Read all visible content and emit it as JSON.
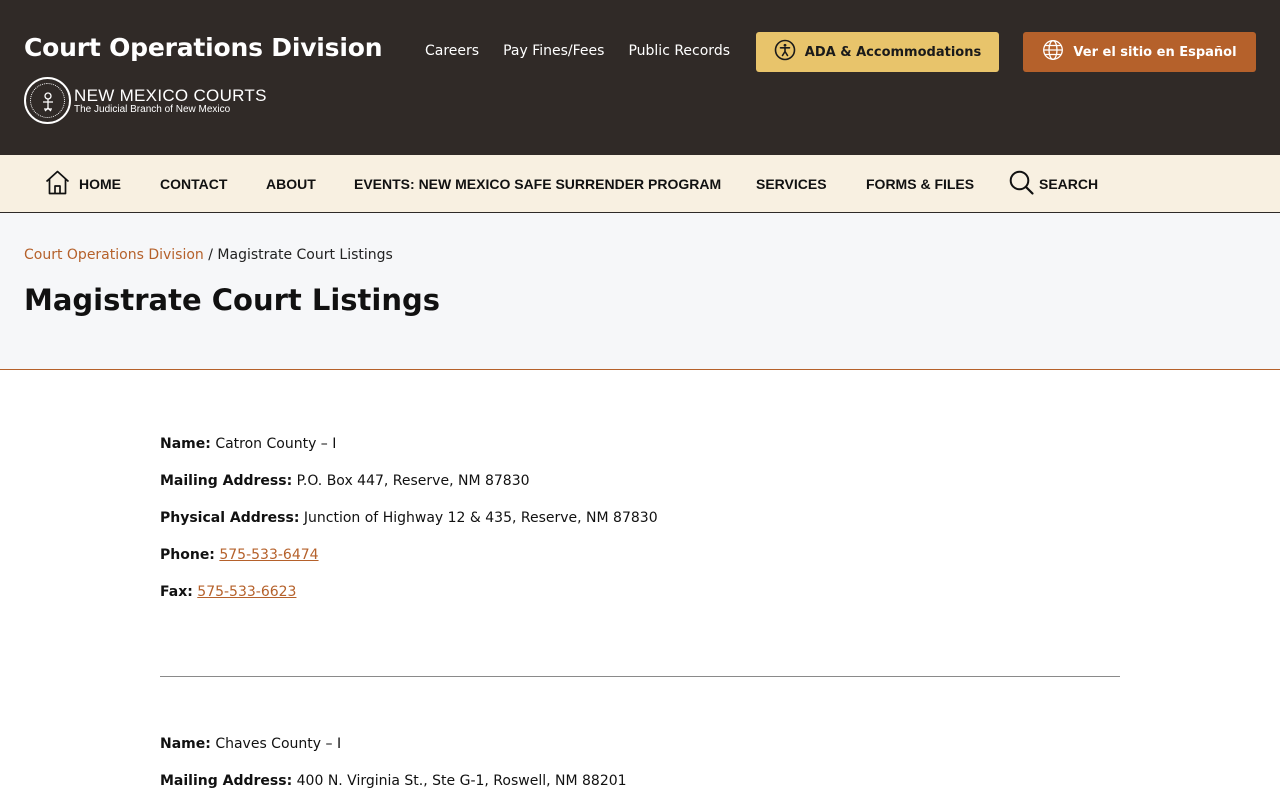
{
  "header": {
    "site_title": "Court Operations Division",
    "logo_main": "NEW MEXICO COURTS",
    "logo_sub": "The Judicial Branch of New Mexico",
    "links": [
      "Careers",
      "Pay Fines/Fees",
      "Public Records"
    ],
    "ada_button": "ADA & Accommodations",
    "spanish_button": "Ver el sitio en Español"
  },
  "nav": {
    "home": "HOME",
    "contact": "CONTACT",
    "about": "ABOUT",
    "events": "EVENTS: NEW MEXICO SAFE SURRENDER PROGRAM",
    "services": "SERVICES",
    "forms": "FORMS & FILES",
    "search": "SEARCH"
  },
  "breadcrumb": {
    "parent": "Court Operations Division",
    "separator": " / ",
    "current": "Magistrate Court Listings"
  },
  "page_title": "Magistrate Court Listings",
  "labels": {
    "name": "Name:",
    "mailing": "Mailing Address:",
    "physical": "Physical Address:",
    "phone": "Phone:",
    "fax": "Fax:"
  },
  "listings": [
    {
      "name": "Catron County – I",
      "mailing": "P.O. Box 447, Reserve, NM 87830",
      "physical": "Junction of Highway 12 & 435, Reserve, NM 87830",
      "phone": "575-533-6474",
      "fax": "575-533-6623"
    },
    {
      "name": "Chaves County – I",
      "mailing": "400 N. Virginia St., Ste G-1, Roswell, NM 88201"
    }
  ],
  "colors": {
    "header_bg": "#302a27",
    "nav_bg": "#f8f0e1",
    "accent": "#b5612b",
    "ada_button": "#e8c46b"
  }
}
